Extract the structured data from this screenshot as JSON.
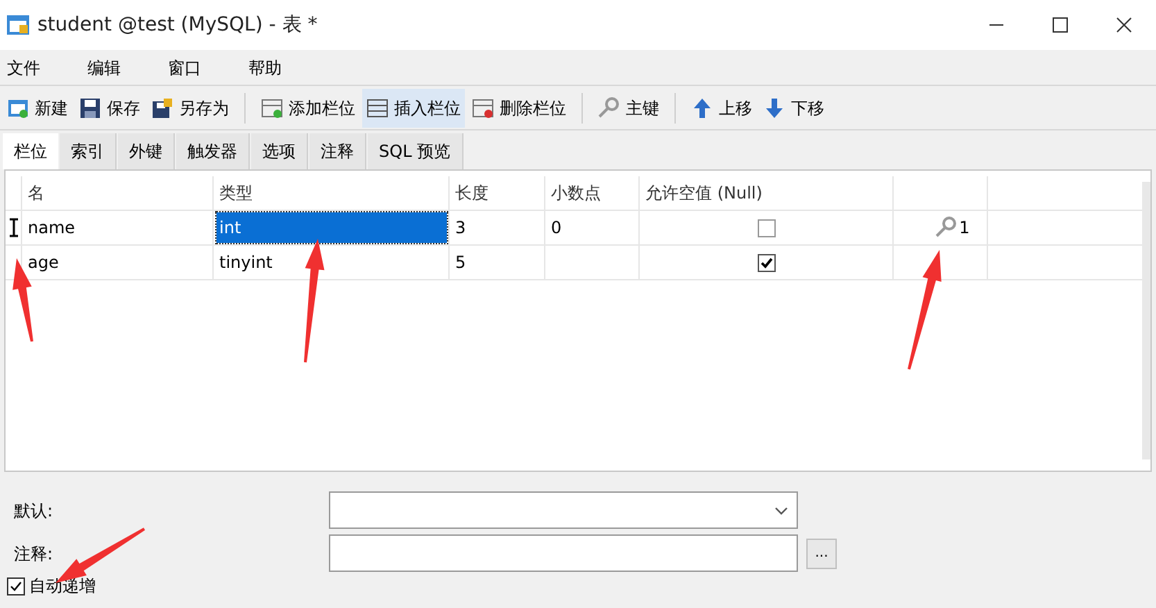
{
  "window": {
    "title": "student @test (MySQL) - 表 *"
  },
  "menu": [
    "文件",
    "编辑",
    "窗口",
    "帮助"
  ],
  "toolbar": [
    {
      "kind": "button",
      "label": "新建",
      "highlighted": false
    },
    {
      "kind": "button",
      "label": "保存",
      "highlighted": false
    },
    {
      "kind": "button",
      "label": "另存为",
      "highlighted": false
    },
    {
      "kind": "separator"
    },
    {
      "kind": "button",
      "label": "添加栏位",
      "highlighted": false
    },
    {
      "kind": "button",
      "label": "插入栏位",
      "highlighted": true
    },
    {
      "kind": "button",
      "label": "删除栏位",
      "highlighted": false
    },
    {
      "kind": "separator"
    },
    {
      "kind": "button",
      "label": "主键",
      "highlighted": false
    },
    {
      "kind": "separator"
    },
    {
      "kind": "button",
      "label": "上移",
      "highlighted": false
    },
    {
      "kind": "button",
      "label": "下移",
      "highlighted": false
    }
  ],
  "tabs": [
    {
      "label": "栏位",
      "selected": true
    },
    {
      "label": "索引",
      "selected": false
    },
    {
      "label": "外键",
      "selected": false
    },
    {
      "label": "触发器",
      "selected": false
    },
    {
      "label": "选项",
      "selected": false
    },
    {
      "label": "注释",
      "selected": false
    },
    {
      "label": "SQL 预览",
      "selected": false
    }
  ],
  "table": {
    "columns": [
      "名",
      "类型",
      "长度",
      "小数点",
      "允许空值 (Null)"
    ],
    "rows": [
      {
        "current": true,
        "name": "name",
        "type": "int",
        "type_selected": true,
        "length": "3",
        "decimals": "0",
        "nullable": false,
        "key": "1"
      },
      {
        "current": false,
        "name": "age",
        "type": "tinyint",
        "type_selected": false,
        "length": "5",
        "nullable": true
      }
    ]
  },
  "properties": {
    "default_label": "默认:",
    "comment_label": "注释:",
    "comment_button": "...",
    "auto_increment": {
      "label": "自动递增",
      "checked": true
    }
  }
}
